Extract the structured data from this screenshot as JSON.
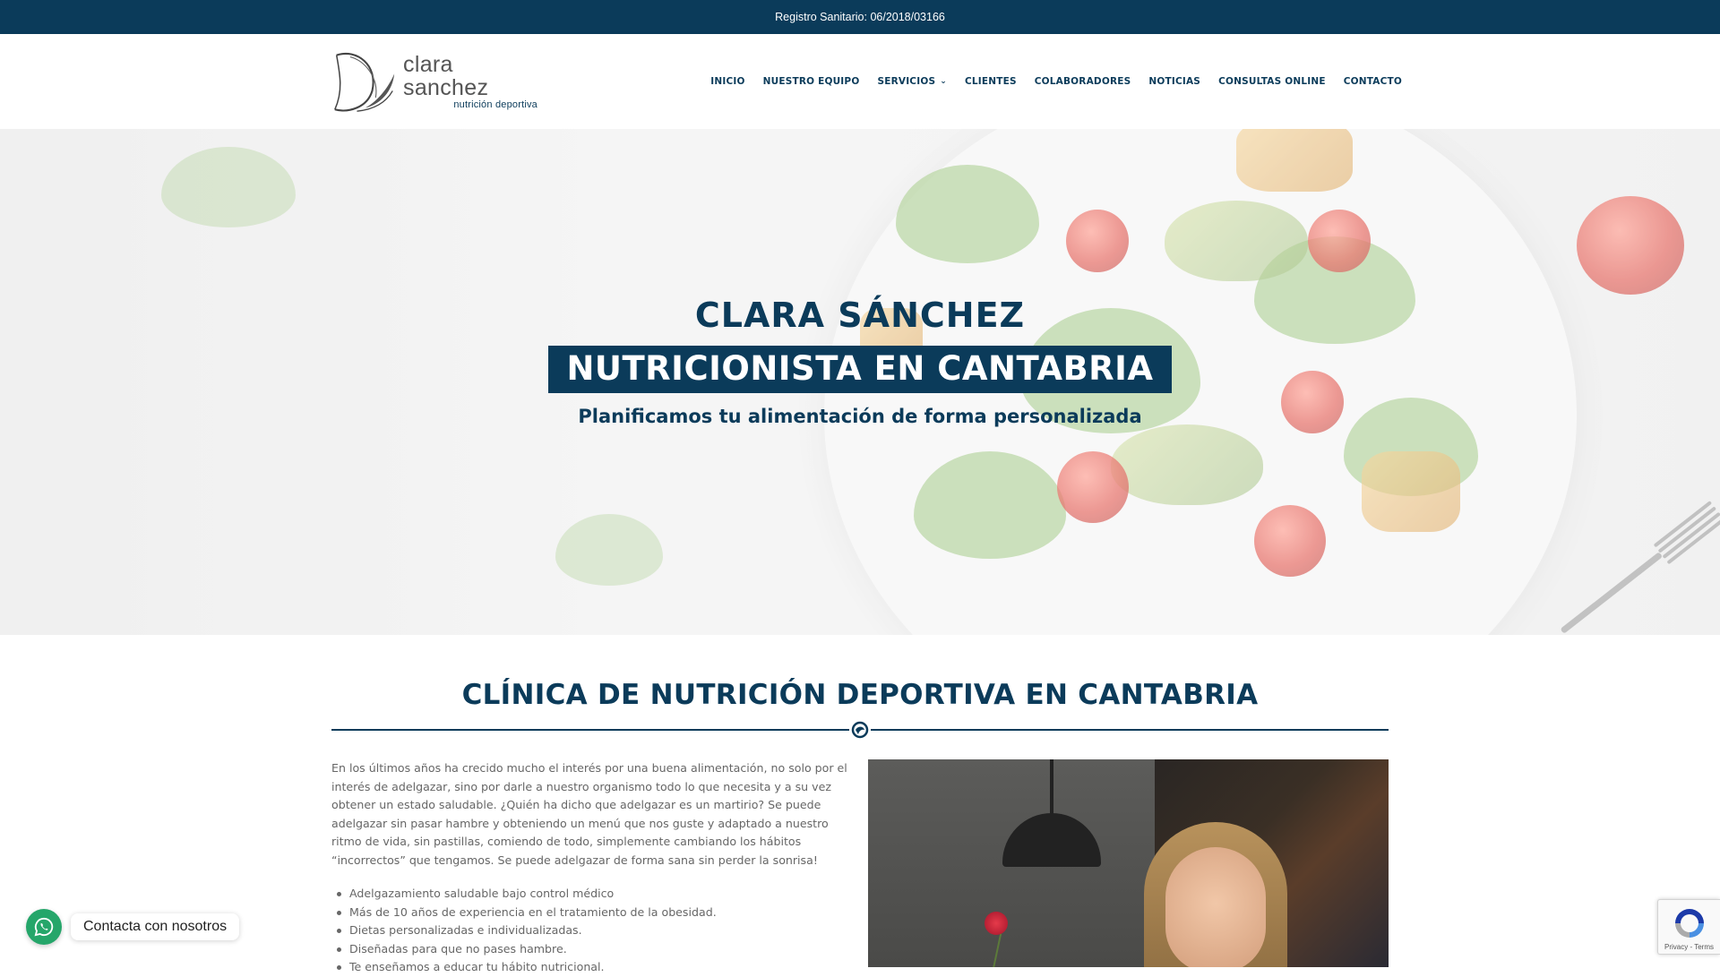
{
  "topbar": {
    "text": "Registro Sanitario: 06/2018/03166"
  },
  "logo": {
    "name": "clara sanchez",
    "subtitle": "nutrición deportiva"
  },
  "nav": {
    "items": [
      {
        "label": "INICIO"
      },
      {
        "label": "NUESTRO EQUIPO"
      },
      {
        "label": "SERVICIOS",
        "has_dropdown": true
      },
      {
        "label": "CLIENTES"
      },
      {
        "label": "COLABORADORES"
      },
      {
        "label": "NOTICIAS"
      },
      {
        "label": "CONSULTAS ONLINE"
      },
      {
        "label": "CONTACTO"
      }
    ]
  },
  "hero": {
    "title": "CLARA SÁNCHEZ",
    "subtitle": "NUTRICIONISTA EN CANTABRIA",
    "tagline": "Planificamos tu alimentación de forma personalizada"
  },
  "section": {
    "title": "CLÍNICA DE NUTRICIÓN DEPORTIVA EN CANTABRIA",
    "paragraph": "En los últimos años ha crecido mucho el interés por una buena alimentación, no solo por el interés de adelgazar, sino por darle a nuestro organismo todo lo que necesita y a su vez obtener un estado saludable. ¿Quién ha dicho que adelgazar es un martirio? Se puede adelgazar sin pasar hambre y obteniendo un menú que nos guste y adaptado a nuestro ritmo de vida, sin pastillas, comiendo de todo, simplemente cambiando los hábitos “incorrectos” que tengamos. Se puede adelgazar de forma sana sin perder la sonrisa!",
    "bullets": [
      "Adelgazamiento saludable bajo control médico",
      "Más de 10 años de experiencia en el tratamiento de la obesidad.",
      "Dietas personalizadas e individualizadas.",
      "Diseñadas para que no pases hambre.",
      "Te enseñamos a educar tu hábito nutricional."
    ]
  },
  "chat": {
    "label": "Contacta con nosotros"
  },
  "recaptcha": {
    "links": "Privacy - Terms"
  },
  "colors": {
    "brand": "#0b3b5a",
    "whatsapp": "#25a66a"
  }
}
